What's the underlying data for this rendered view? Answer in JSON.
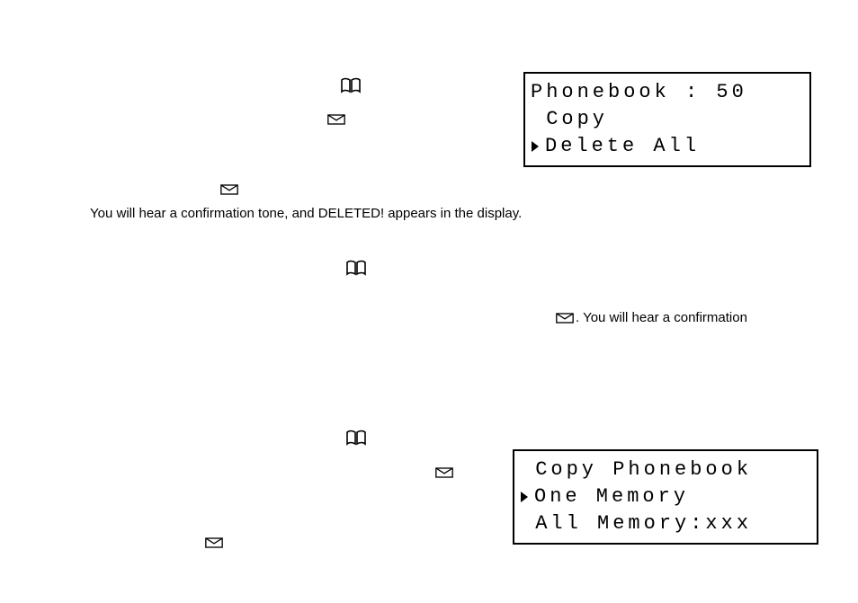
{
  "icons": {
    "book": "book-icon",
    "envelope": "envelope-icon",
    "cursor": "cursor-icon"
  },
  "section1": {
    "lcd": {
      "line1": "Phonebook : 50",
      "line2": " Copy",
      "line3": "Delete All"
    },
    "resultText": "You will hear a confirmation tone, and DELETED! appears in the display."
  },
  "section2": {
    "tail": ". You will hear a confirmation"
  },
  "section3": {
    "lcd": {
      "line1": " Copy Phonebook",
      "line2": "One Memory",
      "line3": " All Memory:xxx"
    }
  }
}
